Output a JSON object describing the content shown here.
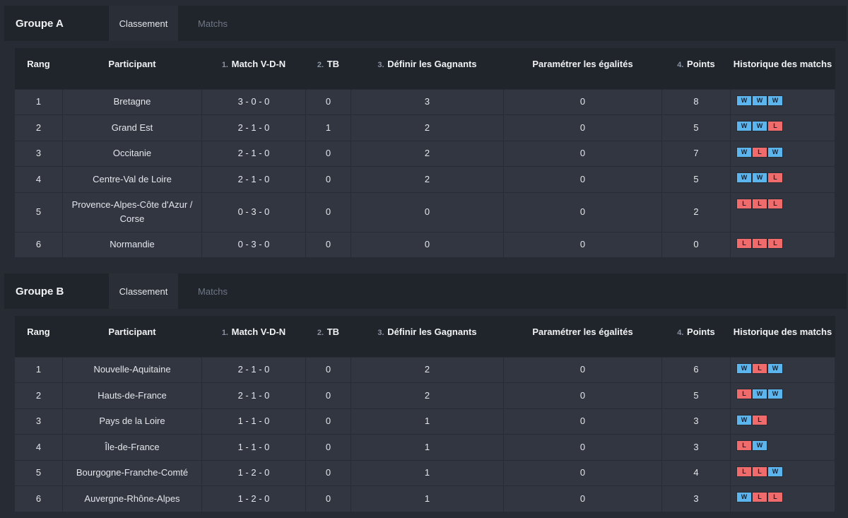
{
  "tabs": {
    "ranking": "Classement",
    "matches": "Matchs"
  },
  "columns": {
    "rank": "Rang",
    "participant": "Participant",
    "record_num": "1.",
    "record": "Match V-D-N",
    "tb_num": "2.",
    "tb": "TB",
    "winners_num": "3.",
    "winners": "Définir les Gagnants",
    "ties": "Paramétrer les égalités",
    "points_num": "4.",
    "points": "Points",
    "history": "Historique des matchs"
  },
  "colors": {
    "win": "#5db5ee",
    "loss": "#f06b6b"
  },
  "groups": [
    {
      "title": "Groupe A",
      "rows": [
        {
          "rank": "1",
          "participant": "Bretagne",
          "record": "3 - 0 - 0",
          "tb": "0",
          "winners": "3",
          "ties": "0",
          "points": "8",
          "history": [
            "W",
            "W",
            "W"
          ]
        },
        {
          "rank": "2",
          "participant": "Grand Est",
          "record": "2 - 1 - 0",
          "tb": "1",
          "winners": "2",
          "ties": "0",
          "points": "5",
          "history": [
            "W",
            "W",
            "L"
          ]
        },
        {
          "rank": "3",
          "participant": "Occitanie",
          "record": "2 - 1 - 0",
          "tb": "0",
          "winners": "2",
          "ties": "0",
          "points": "7",
          "history": [
            "W",
            "L",
            "W"
          ]
        },
        {
          "rank": "4",
          "participant": "Centre-Val de Loire",
          "record": "2 - 1 - 0",
          "tb": "0",
          "winners": "2",
          "ties": "0",
          "points": "5",
          "history": [
            "W",
            "W",
            "L"
          ]
        },
        {
          "rank": "5",
          "participant": "Provence-Alpes-Côte d'Azur / Corse",
          "record": "0 - 3 - 0",
          "tb": "0",
          "winners": "0",
          "ties": "0",
          "points": "2",
          "history": [
            "L",
            "L",
            "L"
          ]
        },
        {
          "rank": "6",
          "participant": "Normandie",
          "record": "0 - 3 - 0",
          "tb": "0",
          "winners": "0",
          "ties": "0",
          "points": "0",
          "history": [
            "L",
            "L",
            "L"
          ]
        }
      ]
    },
    {
      "title": "Groupe B",
      "rows": [
        {
          "rank": "1",
          "participant": "Nouvelle-Aquitaine",
          "record": "2 - 1 - 0",
          "tb": "0",
          "winners": "2",
          "ties": "0",
          "points": "6",
          "history": [
            "W",
            "L",
            "W"
          ]
        },
        {
          "rank": "2",
          "participant": "Hauts-de-France",
          "record": "2 - 1 - 0",
          "tb": "0",
          "winners": "2",
          "ties": "0",
          "points": "5",
          "history": [
            "L",
            "W",
            "W"
          ]
        },
        {
          "rank": "3",
          "participant": "Pays de la Loire",
          "record": "1 - 1 - 0",
          "tb": "0",
          "winners": "1",
          "ties": "0",
          "points": "3",
          "history": [
            "W",
            "L"
          ]
        },
        {
          "rank": "4",
          "participant": "Île-de-France",
          "record": "1 - 1 - 0",
          "tb": "0",
          "winners": "1",
          "ties": "0",
          "points": "3",
          "history": [
            "L",
            "W"
          ]
        },
        {
          "rank": "5",
          "participant": "Bourgogne-Franche-Comté",
          "record": "1 - 2 - 0",
          "tb": "0",
          "winners": "1",
          "ties": "0",
          "points": "4",
          "history": [
            "L",
            "L",
            "W"
          ]
        },
        {
          "rank": "6",
          "participant": "Auvergne-Rhône-Alpes",
          "record": "1 - 2 - 0",
          "tb": "0",
          "winners": "1",
          "ties": "0",
          "points": "3",
          "history": [
            "W",
            "L",
            "L"
          ]
        }
      ]
    }
  ]
}
